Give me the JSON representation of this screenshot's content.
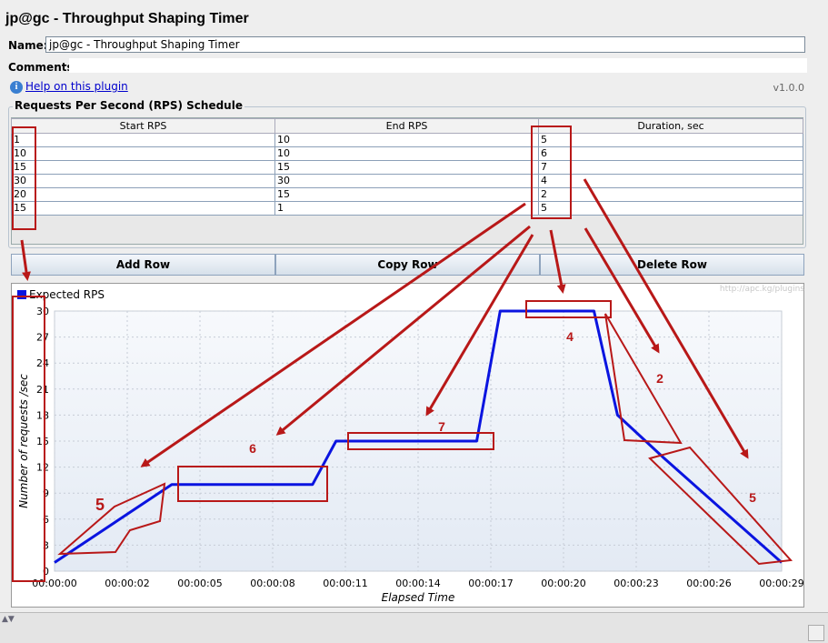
{
  "window": {
    "title": "jp@gc - Throughput Shaping Timer"
  },
  "form": {
    "name_label": "Name:",
    "name_value": "jp@gc - Throughput Shaping Timer",
    "comments_label": "Comments:",
    "help_link": "Help on this plugin",
    "version": "v1.0.0",
    "info_icon": "i"
  },
  "schedule": {
    "legend": "Requests Per Second (RPS) Schedule",
    "headers": [
      "Start RPS",
      "End RPS",
      "Duration, sec"
    ],
    "rows": [
      [
        "1",
        "10",
        "5"
      ],
      [
        "10",
        "10",
        "6"
      ],
      [
        "15",
        "15",
        "7"
      ],
      [
        "30",
        "30",
        "4"
      ],
      [
        "20",
        "15",
        "2"
      ],
      [
        "15",
        "1",
        "5"
      ]
    ],
    "buttons": {
      "add": "Add Row",
      "copy": "Copy Row",
      "delete": "Delete Row"
    }
  },
  "chart": {
    "watermark": "http://apc.kg/plugins"
  },
  "chart_data": {
    "type": "line",
    "series": [
      {
        "name": "Expected RPS",
        "color": "#0a14e0",
        "points": [
          [
            0,
            1
          ],
          [
            5,
            10
          ],
          [
            11,
            10
          ],
          [
            12,
            15
          ],
          [
            18,
            15
          ],
          [
            19,
            30
          ],
          [
            23,
            30
          ],
          [
            24,
            18
          ],
          [
            26,
            13
          ],
          [
            31,
            1
          ]
        ]
      }
    ],
    "xlabel": "Elapsed Time",
    "ylabel": "Number of requests /sec",
    "xticks": [
      "00:00:00",
      "00:00:02",
      "00:00:05",
      "00:00:08",
      "00:00:11",
      "00:00:14",
      "00:00:17",
      "00:00:20",
      "00:00:23",
      "00:00:26",
      "00:00:29"
    ],
    "yticks": [
      "0",
      "3",
      "6",
      "9",
      "12",
      "15",
      "18",
      "21",
      "24",
      "27",
      "30"
    ],
    "ylim": [
      0,
      30
    ],
    "legend_position": "top-left",
    "grid": true,
    "annotations": [
      "5",
      "6",
      "7",
      "4",
      "2",
      "5"
    ]
  },
  "colors": {
    "annotation": "#b81818",
    "series": "#0a14e0"
  }
}
